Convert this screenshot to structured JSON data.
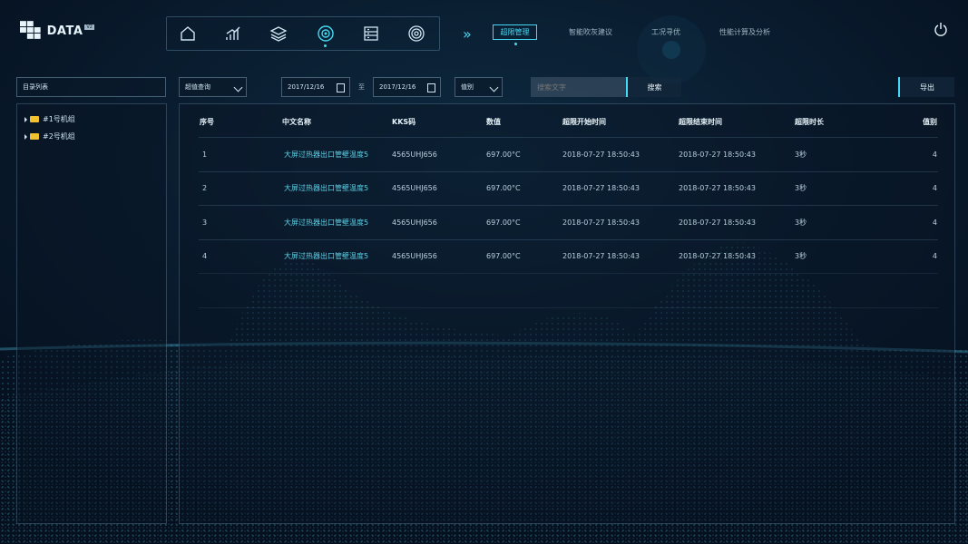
{
  "logo": {
    "text": "DATA",
    "badge": "V2"
  },
  "nav": {
    "icons": [
      "home-icon",
      "chart-icon",
      "layers-icon",
      "target-icon",
      "server-icon",
      "radar-icon"
    ],
    "active_index": 3
  },
  "tabs": {
    "active": "超限管理",
    "items": [
      "智能吹灰建议",
      "工况寻优",
      "性能计算及分析"
    ]
  },
  "toolbar": {
    "dir_label": "目录列表",
    "query_type": "超值查询",
    "date_from": "2017/12/16",
    "to_label": "至",
    "date_to": "2017/12/16",
    "category": "值别",
    "search_placeholder": "搜索文字",
    "search_button": "搜索",
    "export_button": "导出"
  },
  "tree": [
    {
      "label": "#1号机组"
    },
    {
      "label": "#2号机组"
    }
  ],
  "table": {
    "headers": [
      "序号",
      "中文名称",
      "KKS码",
      "数值",
      "超限开始时间",
      "超限结束时间",
      "超限时长",
      "值别"
    ],
    "rows": [
      [
        "1",
        "大屏过热器出口管壁温度5",
        "4565UHJ656",
        "697.00°C",
        "2018-07-27 18:50:43",
        "2018-07-27 18:50:43",
        "3秒",
        "4"
      ],
      [
        "2",
        "大屏过热器出口管壁温度5",
        "4565UHJ656",
        "697.00°C",
        "2018-07-27 18:50:43",
        "2018-07-27 18:50:43",
        "3秒",
        "4"
      ],
      [
        "3",
        "大屏过热器出口管壁温度5",
        "4565UHJ656",
        "697.00°C",
        "2018-07-27 18:50:43",
        "2018-07-27 18:50:43",
        "3秒",
        "4"
      ],
      [
        "4",
        "大屏过热器出口管壁温度5",
        "4565UHJ656",
        "697.00°C",
        "2018-07-27 18:50:43",
        "2018-07-27 18:50:43",
        "3秒",
        "4"
      ]
    ]
  },
  "colors": {
    "accent": "#46d7f2",
    "background": "#071427",
    "folder": "#f2c12e"
  }
}
